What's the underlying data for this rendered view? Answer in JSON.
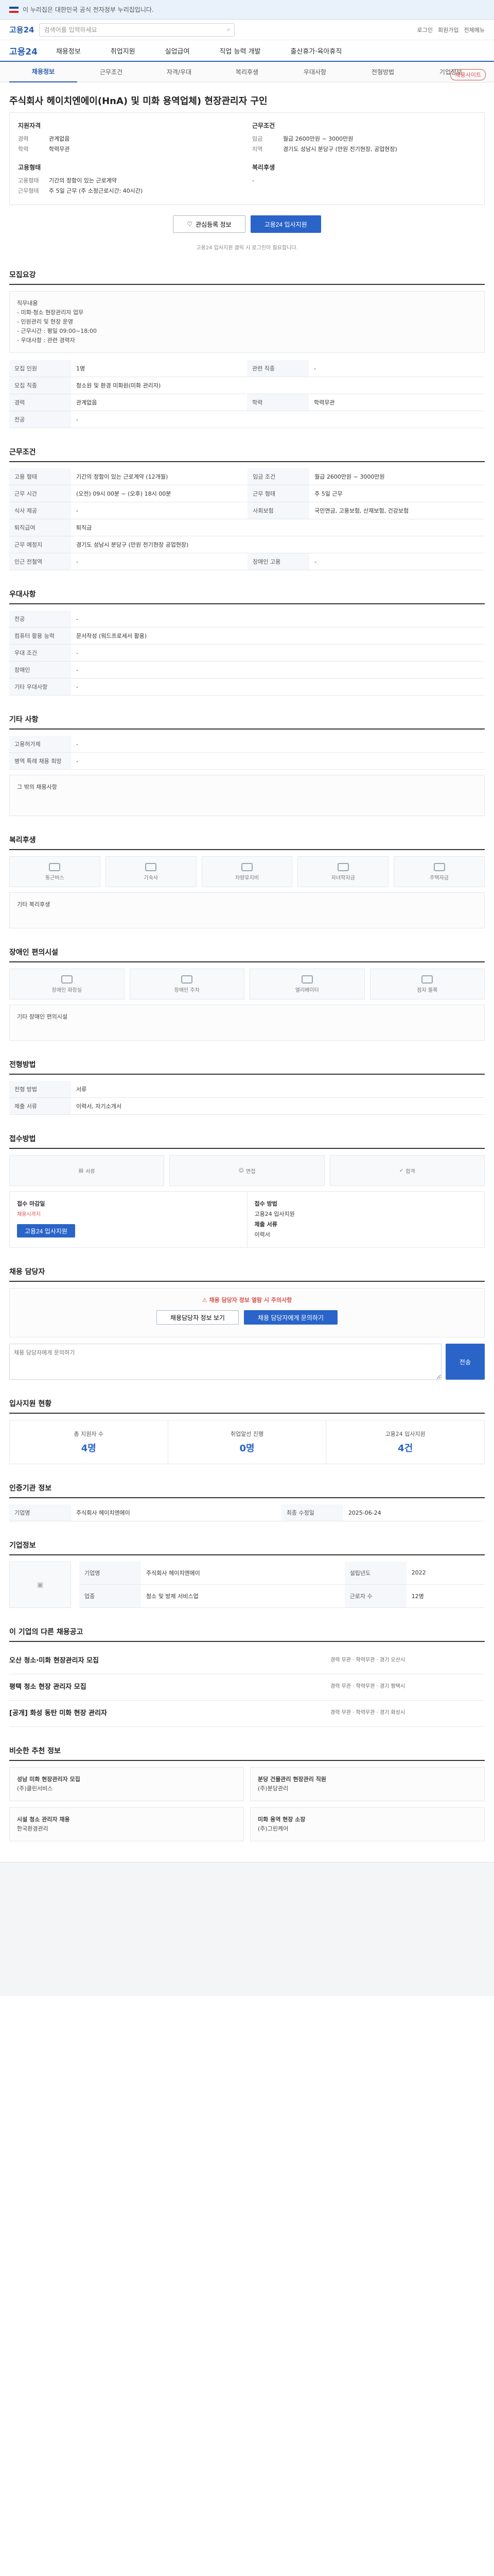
{
  "banner": {
    "text": "이 누리집은 대한민국 공식 전자정부 누리집입니다."
  },
  "header": {
    "logo": "고용24",
    "search_placeholder": "검색어를 입력하세요",
    "util": [
      "로그인",
      "회원가입",
      "전체메뉴"
    ]
  },
  "gnb": {
    "home": "고용24",
    "menu": [
      "채용정보",
      "취업지원",
      "실업급여",
      "직업 능력 개발",
      "출산휴가·육아휴직"
    ]
  },
  "subnav": [
    "채용정보",
    "근무조건",
    "자격/우대",
    "복리후생",
    "우대사항",
    "전형방법",
    "기업정보"
  ],
  "badge": "채용사이트",
  "job": {
    "title": "주식회사 헤이치엔에이(HnA) 및 미화 용역업체) 현장관리자 구인"
  },
  "summary": {
    "left_head": "지원자격",
    "left": [
      {
        "k": "경력",
        "v": "관계없음"
      },
      {
        "k": "학력",
        "v": "학력무관"
      }
    ],
    "right_head": "근무조건",
    "right": [
      {
        "k": "임금",
        "v": "월급 2600만원 ~ 3000만원"
      },
      {
        "k": "지역",
        "v": "경기도 성남시 분당구 (만원 전기현장, 공업현장)"
      }
    ],
    "left2_head": "고용형태",
    "left2": [
      {
        "k": "고용형태",
        "v": "기간의 정함이 있는 근로계약"
      },
      {
        "k": "근무형태",
        "v": "주 5일 근무 (주 소정근로시간: 40시간)"
      }
    ],
    "right2_head": "복리후생",
    "right2": [
      {
        "k": "",
        "v": "-"
      }
    ]
  },
  "buttons": {
    "scrap": "관심등록 정보",
    "apply": "고용24 입사지원"
  },
  "apply_notice": "고용24 입사지원 클릭 시 로그인이 필요합니다.",
  "recruit": {
    "title": "모집요강",
    "desc_lines": [
      "직무내용",
      "- 미화·청소 현장관리자 업무",
      "- 인원관리 및 현장 운영",
      "- 근무시간 : 평일 09:00~18:00",
      "- 우대사항 : 관련 경력자"
    ],
    "rows": [
      {
        "k": "모집 인원",
        "v": "1명"
      },
      {
        "k": "모집 직종",
        "v": "청소원 및 환경 미화원(미화 관리자)"
      },
      {
        "k": "관련 직종",
        "v": "-"
      },
      {
        "k": "경력",
        "v": "관계없음"
      },
      {
        "k": "학력",
        "v": "학력무관"
      },
      {
        "k": "전공",
        "v": "-"
      }
    ]
  },
  "conditions": {
    "title": "근무조건",
    "rows": [
      {
        "k": "고용 형태",
        "v": "기간의 정함이 있는 근로계약 (12개월)"
      },
      {
        "k": "임금 조건",
        "v": "월급 2600만원 ~ 3000만원"
      },
      {
        "k": "근무 시간",
        "v": "(오전) 09시 00분 ~ (오후) 18시 00분"
      },
      {
        "k": "근무 형태",
        "v": "주 5일 근무"
      },
      {
        "k": "식사 제공",
        "v": "-"
      },
      {
        "k": "사회보험",
        "v": "국민연금, 고용보험, 산재보험, 건강보험"
      },
      {
        "k": "퇴직급여",
        "v": "퇴직금"
      },
      {
        "k": "근무 예정지",
        "v": "경기도 성남시 분당구 (만원 전기현장 공업현장)"
      },
      {
        "k": "인근 전철역",
        "v": "-"
      },
      {
        "k": "장애인 고용",
        "v": "-"
      }
    ]
  },
  "qualification": {
    "title": "우대사항",
    "rows": [
      {
        "k": "전공",
        "v": "-"
      },
      {
        "k": "컴퓨터 활용 능력",
        "v": "문서작성 (워드프로세서 활용)"
      },
      {
        "k": "우대 조건",
        "v": "-"
      },
      {
        "k": "장애인",
        "v": "-"
      },
      {
        "k": "기타 우대사항",
        "v": "-"
      }
    ]
  },
  "other": {
    "title": "기타 사항",
    "rows": [
      {
        "k": "고용허가제",
        "v": "-"
      },
      {
        "k": "병역 특례 채용 희망",
        "v": "-"
      }
    ],
    "etc": "그 밖의 채용사항"
  },
  "welfare": {
    "title": "복리후생",
    "tiles": [
      "통근버스",
      "기숙사",
      "차량유지비",
      "자녀학자금",
      "주택자금"
    ],
    "etc": "기타 복리후생"
  },
  "disabled": {
    "title": "장애인 편의시설",
    "tiles": [
      "장애인 화장실",
      "장애인 주차",
      "엘리베이터",
      "점자 블록"
    ],
    "etc": "기타 장애인 편의시설"
  },
  "process": {
    "title": "전형방법",
    "rows": [
      {
        "k": "전형 방법",
        "v": "서류"
      },
      {
        "k": "제출 서류",
        "v": "이력서, 자기소개서"
      }
    ]
  },
  "apply_method": {
    "title": "접수방법",
    "tabs": [
      "서류",
      "면접",
      "합격"
    ],
    "cols": [
      {
        "h": "접수 마감일",
        "v": "채용시까지"
      },
      {
        "h": "접수 방법",
        "v": "고용24 입사지원"
      },
      {
        "h": "제출 서류",
        "v": "이력서"
      }
    ],
    "apply_btn": "고용24 입사지원"
  },
  "manager": {
    "title": "채용 담당자",
    "alert": "채용 담당자 정보 열람 시 주의사항",
    "btn1": "채용담당자 정보 보기",
    "btn2": "채용 담당자에게 문의하기",
    "ask_placeholder": "채용 담당자에게 문의하기",
    "send": "전송"
  },
  "stats": {
    "title": "입사지원 현황",
    "items": [
      {
        "k": "총 지원자 수",
        "v": "4명"
      },
      {
        "k": "취업알선 진행",
        "v": "0명"
      },
      {
        "k": "고용24 입사지원",
        "v": "4건"
      }
    ]
  },
  "info": {
    "title": "인증기관 정보",
    "rows": [
      {
        "k": "기업명",
        "v": "주식회사 헤이치엔에이"
      },
      {
        "k": "최종 수정일",
        "v": "2025-06-24"
      }
    ]
  },
  "company": {
    "title": "기업정보",
    "rows": [
      {
        "k": "기업명",
        "v": "주식회사 헤이치엔에이"
      },
      {
        "k": "업종",
        "v": "청소 및 방제 서비스업"
      },
      {
        "k": "근로자 수",
        "v": "12명"
      },
      {
        "k": "설립년도",
        "v": "2022"
      }
    ]
  },
  "related": {
    "title": "이 기업의 다른 채용공고",
    "items": [
      {
        "name": "오산 청소·미화 현장관리자 모집",
        "info": "경력 무관 · 학력무관 · 경기 오산시"
      },
      {
        "name": "평택 청소 현장 관리자 모집",
        "info": "경력 무관 · 학력무관 · 경기 평택시"
      },
      {
        "name": "[공개] 화성 동탄 미화 현장 관리자",
        "info": "경력 무관 · 학력무관 · 경기 화성시"
      }
    ]
  },
  "recommend": {
    "title": "비슷한 추천 정보",
    "items": [
      {
        "name": "성남 미화 현장관리자 모집",
        "org": "(주)클린서비스"
      },
      {
        "name": "분당 건물관리 현장관리 직원",
        "org": "(주)분당관리"
      },
      {
        "name": "시설 청소 관리자 채용",
        "org": "한국환경관리"
      },
      {
        "name": "미화 용역 현장 소장",
        "org": "(주)그린케어"
      }
    ]
  }
}
